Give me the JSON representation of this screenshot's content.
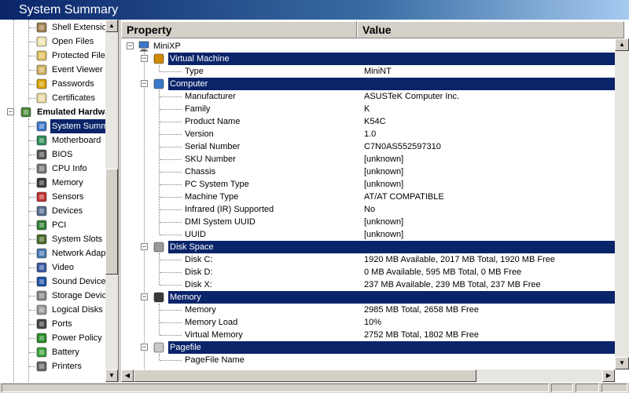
{
  "window": {
    "title": "System Summary"
  },
  "sidebar": {
    "items": [
      {
        "label": "Shell Extensions",
        "icon": "gear-page-icon"
      },
      {
        "label": "Open Files",
        "icon": "document-icon"
      },
      {
        "label": "Protected Files",
        "icon": "protected-document-icon"
      },
      {
        "label": "Event Viewer",
        "icon": "event-log-icon"
      },
      {
        "label": "Passwords",
        "icon": "key-icon"
      },
      {
        "label": "Certificates",
        "icon": "certificate-icon"
      },
      {
        "label": "Emulated Hardware",
        "icon": "hardware-icon"
      },
      {
        "label": "System Summary",
        "icon": "globe-computer-icon"
      },
      {
        "label": "Motherboard",
        "icon": "motherboard-icon"
      },
      {
        "label": "BIOS",
        "icon": "bios-chip-icon"
      },
      {
        "label": "CPU Info",
        "icon": "cpu-icon"
      },
      {
        "label": "Memory",
        "icon": "memory-icon"
      },
      {
        "label": "Sensors",
        "icon": "thermometer-icon"
      },
      {
        "label": "Devices",
        "icon": "devices-icon"
      },
      {
        "label": "PCI",
        "icon": "pci-card-icon"
      },
      {
        "label": "System Slots",
        "icon": "slots-icon"
      },
      {
        "label": "Network Adapters",
        "icon": "network-icon"
      },
      {
        "label": "Video",
        "icon": "monitor-icon"
      },
      {
        "label": "Sound Devices",
        "icon": "music-note-icon"
      },
      {
        "label": "Storage Devices",
        "icon": "storage-icon"
      },
      {
        "label": "Logical Disks",
        "icon": "disk-icon"
      },
      {
        "label": "Ports",
        "icon": "port-icon"
      },
      {
        "label": "Power Policy",
        "icon": "power-plug-icon"
      },
      {
        "label": "Battery",
        "icon": "battery-icon"
      },
      {
        "label": "Printers",
        "icon": "printer-icon"
      }
    ]
  },
  "table": {
    "headers": {
      "property": "Property",
      "value": "Value"
    },
    "root": "MiniXP",
    "sections": [
      {
        "title": "Virtual Machine",
        "rows": [
          {
            "property": "Type",
            "value": "MiniNT"
          }
        ]
      },
      {
        "title": "Computer",
        "rows": [
          {
            "property": "Manufacturer",
            "value": "ASUSTeK Computer Inc."
          },
          {
            "property": "Family",
            "value": "K"
          },
          {
            "property": "Product Name",
            "value": "K54C"
          },
          {
            "property": "Version",
            "value": "1.0"
          },
          {
            "property": "Serial Number",
            "value": "C7N0AS552597310"
          },
          {
            "property": "SKU Number",
            "value": "[unknown]"
          },
          {
            "property": "Chassis",
            "value": "[unknown]"
          },
          {
            "property": "PC System Type",
            "value": "[unknown]"
          },
          {
            "property": "Machine Type",
            "value": "AT/AT COMPATIBLE"
          },
          {
            "property": "Infrared (IR) Supported",
            "value": "No"
          },
          {
            "property": "DMI System UUID",
            "value": "[unknown]"
          },
          {
            "property": "UUID",
            "value": "[unknown]"
          }
        ]
      },
      {
        "title": "Disk Space",
        "rows": [
          {
            "property": "Disk C:",
            "value": "1920 MB Available, 2017 MB Total, 1920 MB Free"
          },
          {
            "property": "Disk D:",
            "value": "0 MB Available, 595 MB Total, 0 MB Free"
          },
          {
            "property": "Disk X:",
            "value": "237 MB Available, 239 MB Total, 237 MB Free"
          }
        ]
      },
      {
        "title": "Memory",
        "rows": [
          {
            "property": "Memory",
            "value": "2985 MB Total, 2658 MB Free"
          },
          {
            "property": "Memory Load",
            "value": "10%"
          },
          {
            "property": "Virtual Memory",
            "value": "2752 MB Total, 1802 MB Free"
          }
        ]
      },
      {
        "title": "Pagefile",
        "rows": [
          {
            "property": "PageFile Name",
            "value": ""
          }
        ]
      }
    ]
  },
  "colors": {
    "titlebar": "#0a246a",
    "selection": "#0a246a",
    "chrome": "#d4d0c8"
  }
}
